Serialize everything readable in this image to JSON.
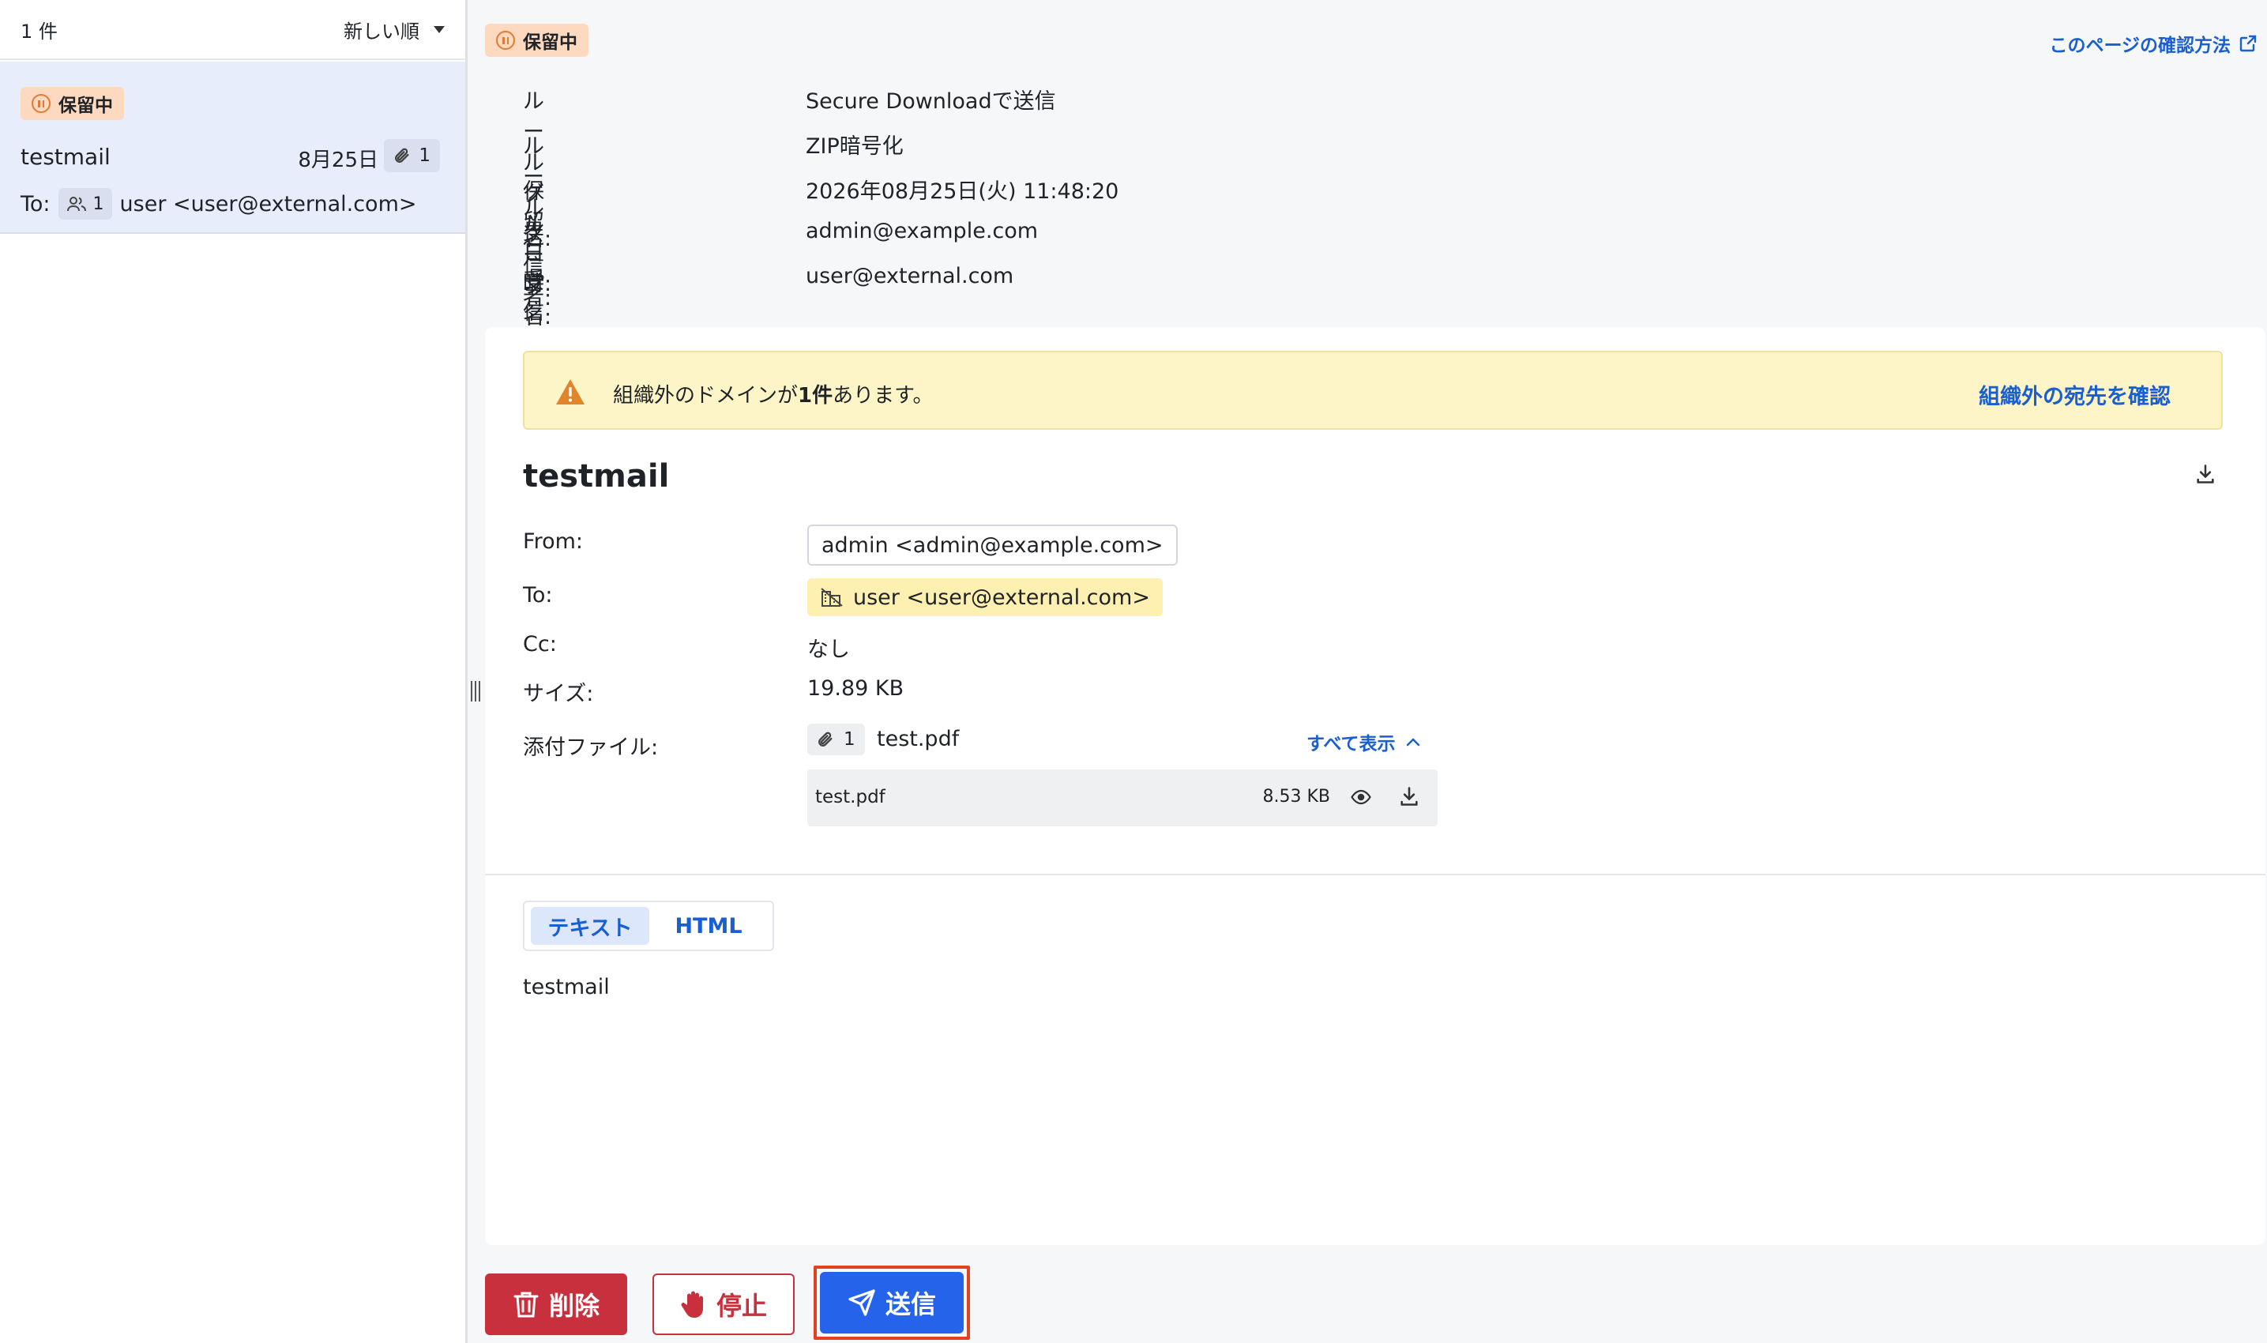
{
  "list": {
    "count_label": "1 件",
    "sort_label": "新しい順",
    "item": {
      "status": "保留中",
      "subject": "testmail",
      "date": "8月25日",
      "attachment_count": "1",
      "to_label": "To:",
      "recipient_count": "1",
      "recipient": "user <user@external.com>"
    }
  },
  "detail": {
    "status": "保留中",
    "help_link": "このページの確認方法",
    "meta": [
      {
        "key": "ルールグループ名:",
        "value": "Secure Downloadで送信"
      },
      {
        "key": "ルール名:",
        "value": "ZIP暗号化"
      },
      {
        "key": "保留日時:",
        "value": "2026年08月25日(火) 11:48:20"
      },
      {
        "key": "送信者:",
        "value": "admin@example.com"
      },
      {
        "key": "受信者:",
        "value": "user@external.com"
      }
    ],
    "warning": {
      "text_before": "組織外のドメインが",
      "text_bold": "1件",
      "text_after": "あります。",
      "link": "組織外の宛先を確認"
    },
    "subject": "testmail",
    "headers": {
      "from_label": "From:",
      "from_value": "admin <admin@example.com>",
      "to_label": "To:",
      "to_value": "user <user@external.com>",
      "cc_label": "Cc:",
      "cc_value": "なし",
      "size_label": "サイズ:",
      "size_value": "19.89 KB",
      "attachments_label": "添付ファイル:",
      "attachment_count": "1",
      "attachment_first": "test.pdf",
      "show_all": "すべて表示"
    },
    "attachments": [
      {
        "name": "test.pdf",
        "size": "8.53 KB"
      }
    ],
    "tabs": [
      {
        "label": "テキスト",
        "active": true
      },
      {
        "label": "HTML",
        "active": false
      }
    ],
    "body": "testmail"
  },
  "actions": {
    "delete": "削除",
    "stop": "停止",
    "send": "送信"
  },
  "colors": {
    "accent": "#1a5fd0",
    "hold_badge": "#fcd9bf",
    "warning_bg": "#fdf5c7",
    "danger": "#c8303d",
    "primary": "#2563eb",
    "highlight_frame": "#e2421f"
  },
  "icons": [
    "pause-circle-icon",
    "caret-down-icon",
    "paperclip-icon",
    "users-icon",
    "external-link-icon",
    "warning-triangle-icon",
    "download-icon",
    "external-domain-icon",
    "eye-icon",
    "chevron-up-icon",
    "trash-icon",
    "hand-stop-icon",
    "send-icon"
  ]
}
